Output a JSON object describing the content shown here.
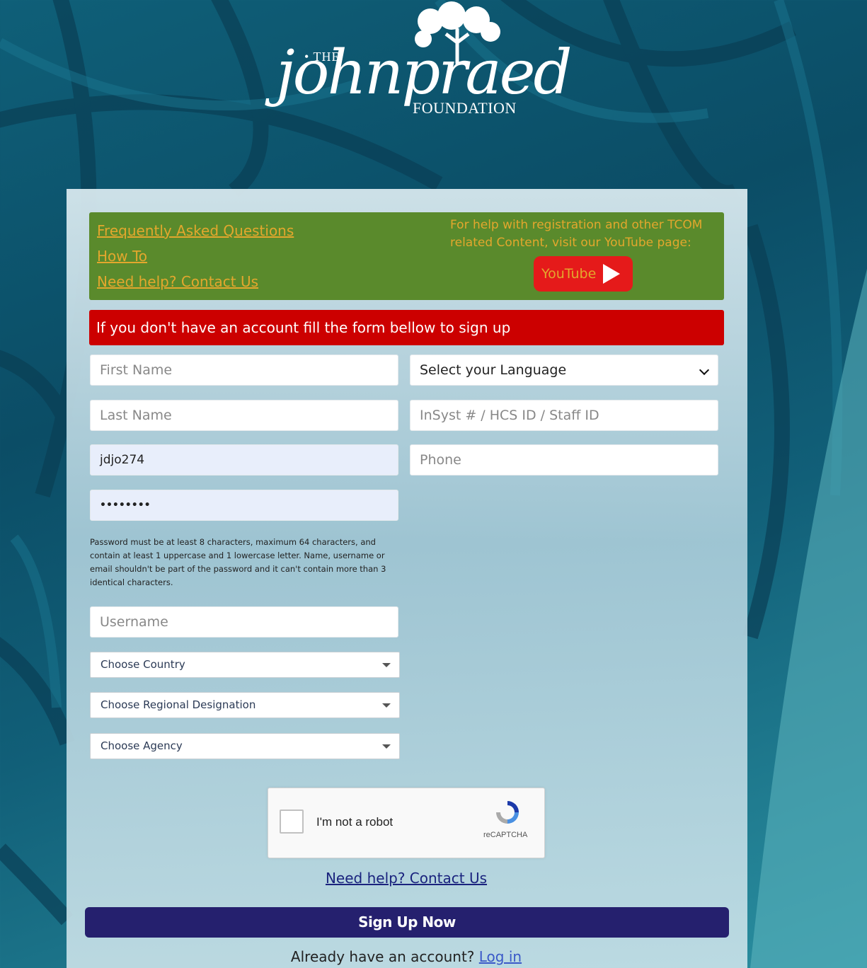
{
  "logo": {
    "the": "• THE",
    "script": "johnpraed",
    "foundation": "FOUNDATION"
  },
  "help": {
    "links": [
      "Frequently Asked Questions",
      "How To",
      "Need help? Contact Us"
    ],
    "youtube_text": "For help with registration and other TCOM related Content, visit our YouTube page:",
    "youtube_label": "YouTube"
  },
  "alert": "If you don't have an account fill the form bellow to sign up",
  "form": {
    "first_name_placeholder": "First Name",
    "last_name_placeholder": "Last Name",
    "email_value": "jdjo274",
    "password_value": "••••••••",
    "password_note": "Password must be at least 8 characters, maximum 64 characters, and contain at least 1 uppercase and 1 lowercase letter. Name, username or email shouldn't be part of the password and it can't contain more than 3 identical characters.",
    "username_placeholder": "Username",
    "country": "Choose Country",
    "regional": "Choose Regional Designation",
    "agency": "Choose Agency",
    "language": "Select your Language",
    "insyst_placeholder": "InSyst # / HCS ID / Staff ID",
    "phone_placeholder": "Phone"
  },
  "captcha": {
    "label": "I'm not a robot",
    "brand": "reCAPTCHA"
  },
  "contact_link": "Need help? Contact Us",
  "signup_button": "Sign Up Now",
  "already": {
    "text": "Already have an account?",
    "login": "Log in"
  },
  "colors": {
    "help_box": "#5a8a2c",
    "help_text": "#e3a72d",
    "alert": "#cc0000",
    "signup": "#25206e"
  }
}
